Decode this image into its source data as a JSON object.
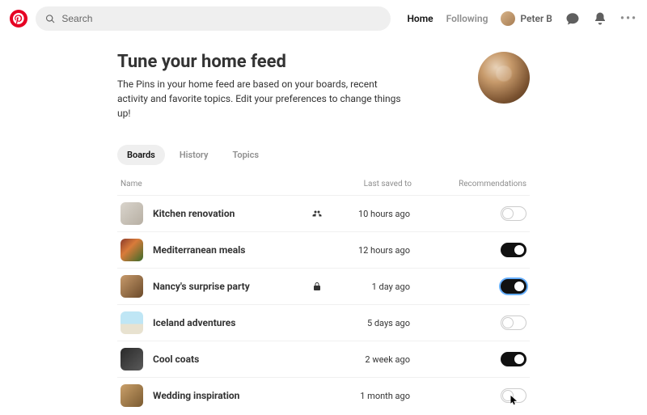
{
  "header": {
    "search_placeholder": "Search",
    "nav_home": "Home",
    "nav_following": "Following",
    "user_name": "Peter B"
  },
  "hero": {
    "title": "Tune your home feed",
    "subtitle": "The Pins in your home feed are based on your boards, recent activity and favorite topics. Edit your preferences to change things up!"
  },
  "tabs": {
    "boards": "Boards",
    "history": "History",
    "topics": "Topics"
  },
  "columns": {
    "name": "Name",
    "saved": "Last saved to",
    "rec": "Recommendations"
  },
  "boards": [
    {
      "name": "Kitchen renovation",
      "saved": "10 hours ago",
      "icon": "group",
      "on": false,
      "focus": false
    },
    {
      "name": "Mediterranean meals",
      "saved": "12 hours ago",
      "icon": "",
      "on": true,
      "focus": false
    },
    {
      "name": "Nancy's surprise party",
      "saved": "1 day ago",
      "icon": "lock",
      "on": true,
      "focus": true
    },
    {
      "name": "Iceland adventures",
      "saved": "5 days ago",
      "icon": "",
      "on": false,
      "focus": false
    },
    {
      "name": "Cool coats",
      "saved": "2 week ago",
      "icon": "",
      "on": true,
      "focus": false
    },
    {
      "name": "Wedding inspiration",
      "saved": "1 month ago",
      "icon": "",
      "on": false,
      "focus": false
    }
  ]
}
